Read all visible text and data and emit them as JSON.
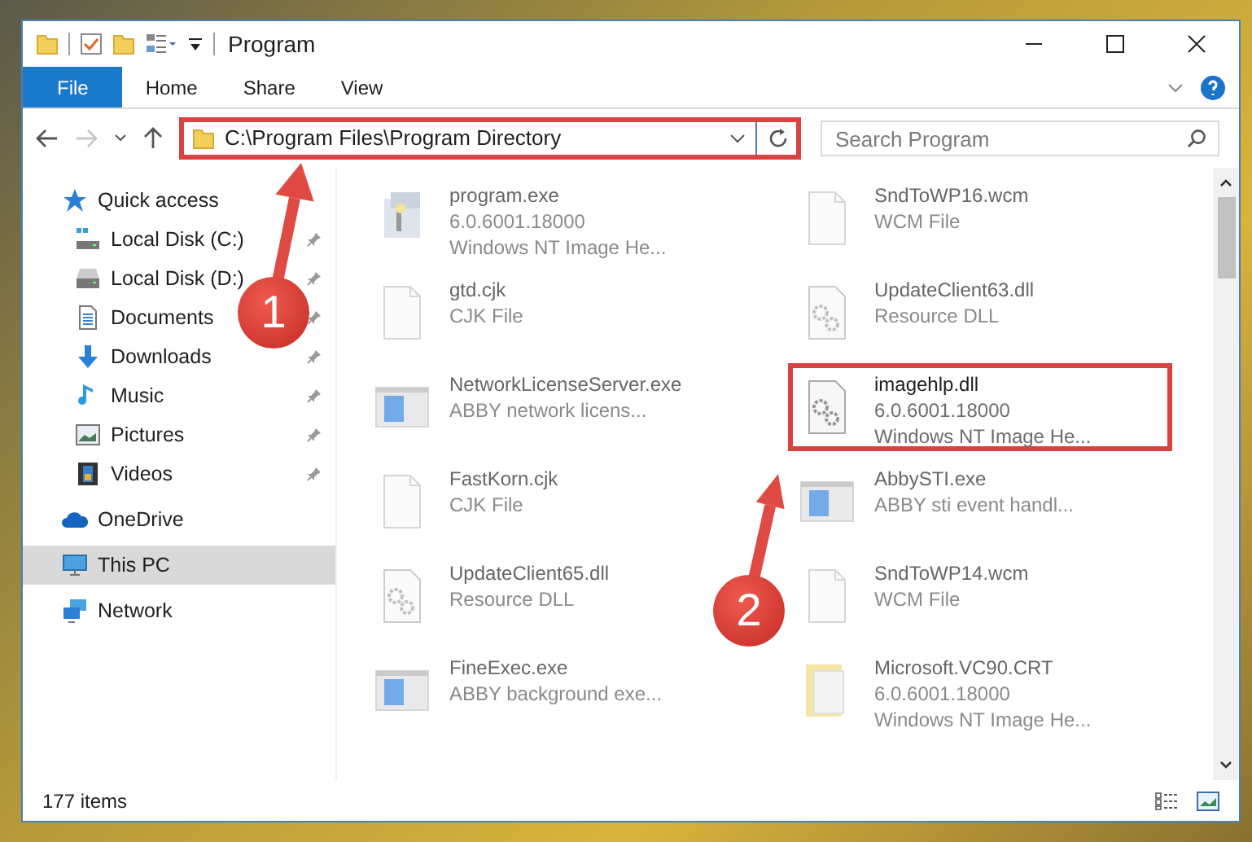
{
  "window": {
    "title": "Program"
  },
  "ribbon_tabs": [
    {
      "label": "File",
      "selected": true
    },
    {
      "label": "Home",
      "selected": false
    },
    {
      "label": "Share",
      "selected": false
    },
    {
      "label": "View",
      "selected": false
    }
  ],
  "address_bar": {
    "path": "C:\\Program Files\\Program Directory",
    "highlighted": true
  },
  "search": {
    "placeholder": "Search Program"
  },
  "sidebar": {
    "items": [
      {
        "label": "Quick access",
        "kind": "star",
        "pinned": false,
        "selected": false,
        "group": true
      },
      {
        "label": "Local Disk (C:)",
        "kind": "drive-c",
        "pinned": true,
        "selected": false,
        "group": false
      },
      {
        "label": "Local Disk (D:)",
        "kind": "drive",
        "pinned": true,
        "selected": false,
        "group": false
      },
      {
        "label": "Documents",
        "kind": "documents",
        "pinned": true,
        "selected": false,
        "group": false
      },
      {
        "label": "Downloads",
        "kind": "downloads",
        "pinned": true,
        "selected": false,
        "group": false
      },
      {
        "label": "Music",
        "kind": "music",
        "pinned": true,
        "selected": false,
        "group": false
      },
      {
        "label": "Pictures",
        "kind": "pictures",
        "pinned": true,
        "selected": false,
        "group": false
      },
      {
        "label": "Videos",
        "kind": "videos",
        "pinned": true,
        "selected": false,
        "group": false
      },
      {
        "label": "OneDrive",
        "kind": "cloud",
        "pinned": false,
        "selected": false,
        "group": true
      },
      {
        "label": "This PC",
        "kind": "pc",
        "pinned": false,
        "selected": true,
        "group": true
      },
      {
        "label": "Network",
        "kind": "network",
        "pinned": false,
        "selected": false,
        "group": true
      }
    ]
  },
  "files": [
    {
      "name": "program.exe",
      "details": [
        "6.0.6001.18000",
        "Windows NT Image He..."
      ],
      "kind": "installer",
      "highlighted": false
    },
    {
      "name": "SndToWP16.wcm",
      "details": [
        "WCM File"
      ],
      "kind": "blank",
      "highlighted": false
    },
    {
      "name": "gtd.cjk",
      "details": [
        "CJK File"
      ],
      "kind": "blank",
      "highlighted": false
    },
    {
      "name": "UpdateClient63.dll",
      "details": [
        "Resource DLL"
      ],
      "kind": "gears",
      "highlighted": false
    },
    {
      "name": "NetworkLicenseServer.exe",
      "details": [
        "ABBY network licens..."
      ],
      "kind": "window",
      "highlighted": false
    },
    {
      "name": "imagehlp.dll",
      "details": [
        "6.0.6001.18000",
        "Windows NT Image He..."
      ],
      "kind": "gears",
      "highlighted": true
    },
    {
      "name": "FastKorn.cjk",
      "details": [
        "CJK File"
      ],
      "kind": "blank",
      "highlighted": false
    },
    {
      "name": "AbbySTI.exe",
      "details": [
        "ABBY sti event handl..."
      ],
      "kind": "window",
      "highlighted": false
    },
    {
      "name": "UpdateClient65.dll",
      "details": [
        "Resource DLL"
      ],
      "kind": "gears",
      "highlighted": false
    },
    {
      "name": "SndToWP14.wcm",
      "details": [
        "WCM File"
      ],
      "kind": "blank",
      "highlighted": false
    },
    {
      "name": "FineExec.exe",
      "details": [
        "ABBY background exe..."
      ],
      "kind": "window",
      "highlighted": false
    },
    {
      "name": "Microsoft.VC90.CRT",
      "details": [
        "6.0.6001.18000",
        "Windows NT Image He..."
      ],
      "kind": "folder",
      "highlighted": false
    }
  ],
  "status_bar": {
    "count": "177 items"
  },
  "annotations": [
    {
      "label": "1"
    },
    {
      "label": "2"
    }
  ]
}
